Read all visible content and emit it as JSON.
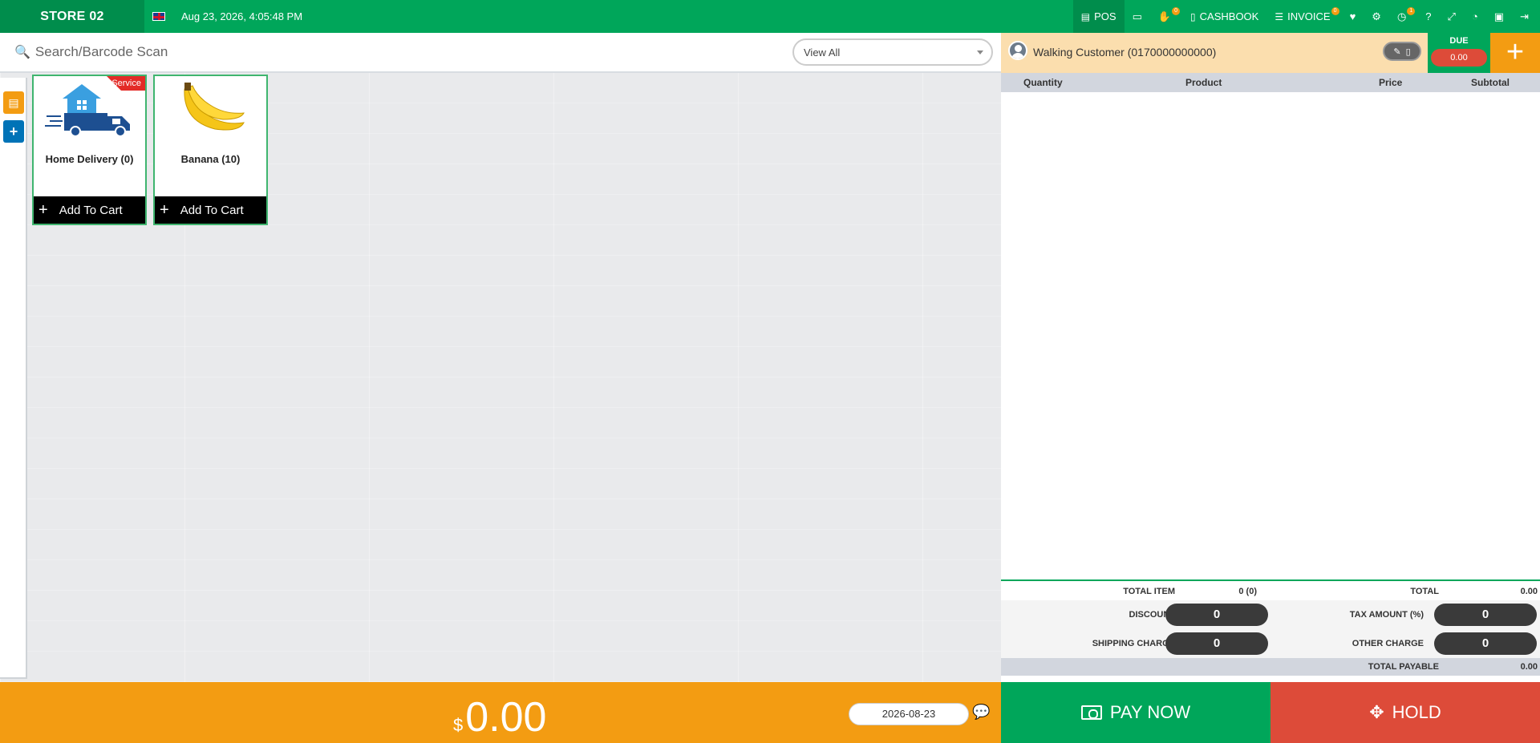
{
  "topbar": {
    "store": "STORE 02",
    "datetime": "Aug 23, 2026, 4:05:48 PM",
    "nav": {
      "pos": "POS",
      "cashbook": "CASHBOOK",
      "invoice": "INVOICE",
      "badge_hand": "0",
      "badge_invoice": "0",
      "badge_clock": "1"
    }
  },
  "search": {
    "placeholder": "Search/Barcode Scan",
    "filter_value": "View All"
  },
  "products": [
    {
      "name": "Home Delivery (0)",
      "tag": "Service",
      "button": "Add To Cart"
    },
    {
      "name": "Banana (10)",
      "button": "Add To Cart"
    }
  ],
  "customer": {
    "name": "Walking Customer (0170000000000)",
    "due_label": "DUE",
    "due_value": "0.00"
  },
  "cart": {
    "columns": [
      "Quantity",
      "Product",
      "Price",
      "Subtotal"
    ]
  },
  "totals": {
    "total_item_label": "TOTAL ITEM",
    "total_item_value": "0 (0)",
    "total_label": "TOTAL",
    "total_value": "0.00",
    "discount_label": "DISCOUNT",
    "discount_value": "0",
    "tax_label": "TAX AMOUNT (%)",
    "tax_value": "0",
    "shipping_label": "SHIPPING CHARGE",
    "shipping_value": "0",
    "other_label": "OTHER CHARGE",
    "other_value": "0",
    "payable_label": "TOTAL PAYABLE",
    "payable_value": "0.00"
  },
  "bottom": {
    "currency": "$",
    "amount": "0.00",
    "date": "2026-08-23",
    "pay_now": "PAY NOW",
    "hold": "HOLD"
  },
  "colors": {
    "green": "#00a65a",
    "dark_green": "#008d4c",
    "orange": "#f39c12",
    "red": "#dd4b39",
    "peach": "#fbdeae"
  }
}
